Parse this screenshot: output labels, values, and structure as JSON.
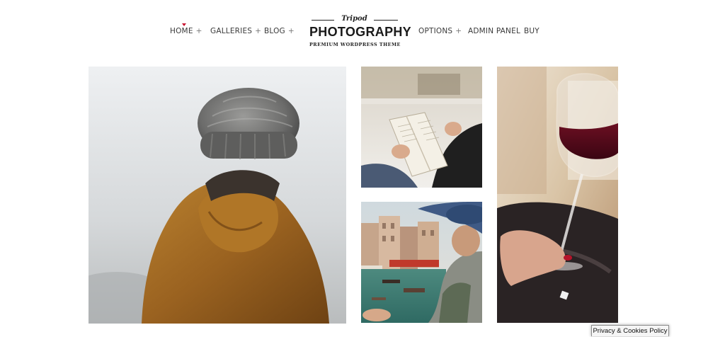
{
  "nav": {
    "left_items": [
      {
        "label": "HOME",
        "plus": "+"
      },
      {
        "label": "GALLERIES",
        "plus": "+"
      },
      {
        "label": "BLOG",
        "plus": "+"
      }
    ],
    "right_items": [
      {
        "label": "OPTIONS",
        "plus": "+"
      },
      {
        "label": "ADMIN PANEL"
      },
      {
        "label": "BUY"
      }
    ],
    "active_item": "HOME",
    "accent_color": "#c8102e"
  },
  "logo": {
    "script": "Tripod",
    "main": "PHOTOGRAPHY",
    "tagline": "PREMIUM WORDPRESS THEME"
  },
  "gallery": {
    "photos": [
      {
        "subject": "person in knit beanie and brown hooded jacket, seen from behind"
      },
      {
        "subject": "person reading a book at a cafe"
      },
      {
        "subject": "woman in sun hat beside a Venice canal"
      },
      {
        "subject": "hand holding a glass of red wine"
      }
    ]
  },
  "cookie": {
    "label": "Privacy & Cookies Policy"
  }
}
